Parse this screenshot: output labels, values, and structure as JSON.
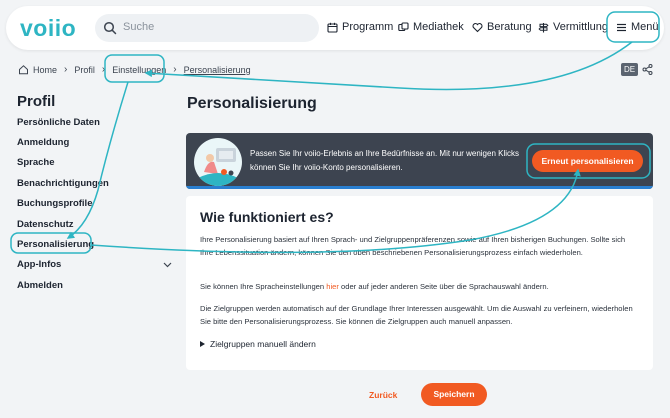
{
  "header": {
    "logo": "voiio",
    "search_placeholder": "Suche",
    "nav": [
      {
        "label": "Programm",
        "icon": "calendar-icon"
      },
      {
        "label": "Mediathek",
        "icon": "media-icon"
      },
      {
        "label": "Beratung",
        "icon": "heart-hand-icon"
      },
      {
        "label": "Vermittlung",
        "icon": "signpost-icon"
      },
      {
        "label": "Menü",
        "icon": "hamburger-icon"
      }
    ]
  },
  "breadcrumb": {
    "home": "Home",
    "items": [
      "Profil",
      "Einstellungen",
      "Personalisierung"
    ]
  },
  "language": "DE",
  "sidebar": {
    "title": "Profil",
    "items": [
      "Persönliche Daten",
      "Anmeldung",
      "Sprache",
      "Benachrichtigungen",
      "Buchungsprofile",
      "Datenschutz",
      "Personalisierung",
      "App-Infos",
      "Abmelden"
    ],
    "active_index": 6
  },
  "main": {
    "title": "Personalisierung",
    "banner": {
      "text": "Passen Sie Ihr voiio-Erlebnis an Ihre Bedürfnisse an. Mit nur wenigen Klicks können Sie Ihr voiio-Konto personalisieren.",
      "button": "Erneut personalisieren"
    },
    "card": {
      "heading": "Wie funktioniert es?",
      "para1": "Ihre Personalisierung basiert auf Ihren Sprach- und Zielgruppenpräferenzen sowie auf Ihren bisherigen Buchungen. Sollte sich Ihre Lebenssituation ändern, können Sie den oben beschriebenen Personalisierungsprozess einfach wiederholen.",
      "para2_before": "Sie können Ihre Spracheinstellungen ",
      "para2_link": "hier",
      "para2_after": " oder auf jeder anderen Seite über die Sprachauswahl ändern.",
      "para3": "Die Zielgruppen werden automatisch auf der Grundlage Ihrer Interessen ausgewählt. Um die Auswahl zu verfeinern, wiederholen Sie bitte den Personalisierungsprozess. Sie können die Zielgruppen auch manuell anpassen.",
      "expander": "Zielgruppen manuell ändern"
    },
    "back_label": "Zurück",
    "save_label": "Speichern"
  },
  "colors": {
    "brand": "#2eb5c3",
    "accent": "#f15a22",
    "banner_bg": "#3d4450",
    "annotation": "#2eb5c3"
  }
}
